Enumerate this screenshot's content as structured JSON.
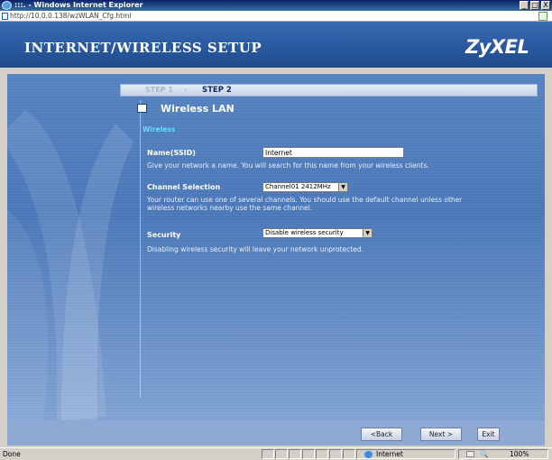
{
  "window": {
    "title": ":::. - Windows Internet Explorer",
    "min_label": "_",
    "max_label": "□",
    "close_label": "X",
    "address": "http://10.0.0.138/wzWLAN_Cfg.html"
  },
  "header": {
    "title": "INTERNET/WIRELESS SETUP",
    "logo": "ZyXEL"
  },
  "steps": {
    "step1": "STEP 1",
    "arrow": "›",
    "step2": "STEP 2"
  },
  "section": {
    "title": "Wireless LAN",
    "subtitle": "Wireless"
  },
  "fields": {
    "ssid": {
      "label": "Name(SSID)",
      "value": "Internet",
      "desc": "Give your network a name. You will search for this name from your wireless clients."
    },
    "channel": {
      "label": "Channel Selection",
      "value": "Channel01 2412MHz",
      "desc1": "Your router can use one of several channels. You should use the default channel unless other",
      "desc2": "wireless networks nearby use the same channel."
    },
    "security": {
      "label": "Security",
      "value": "Disable wireless security",
      "desc": "Disabling wireless security will leave your network unprotected."
    }
  },
  "buttons": {
    "back": "<Back",
    "next": "Next >",
    "exit": "Exit"
  },
  "status": {
    "text": "Done",
    "zone": "Internet",
    "zoom": "100%",
    "zoom_prefix": "\u0001"
  },
  "colors": {
    "header": "#2d5ea5",
    "panel": "#4a77b8",
    "accent": "#5fe0ff"
  }
}
